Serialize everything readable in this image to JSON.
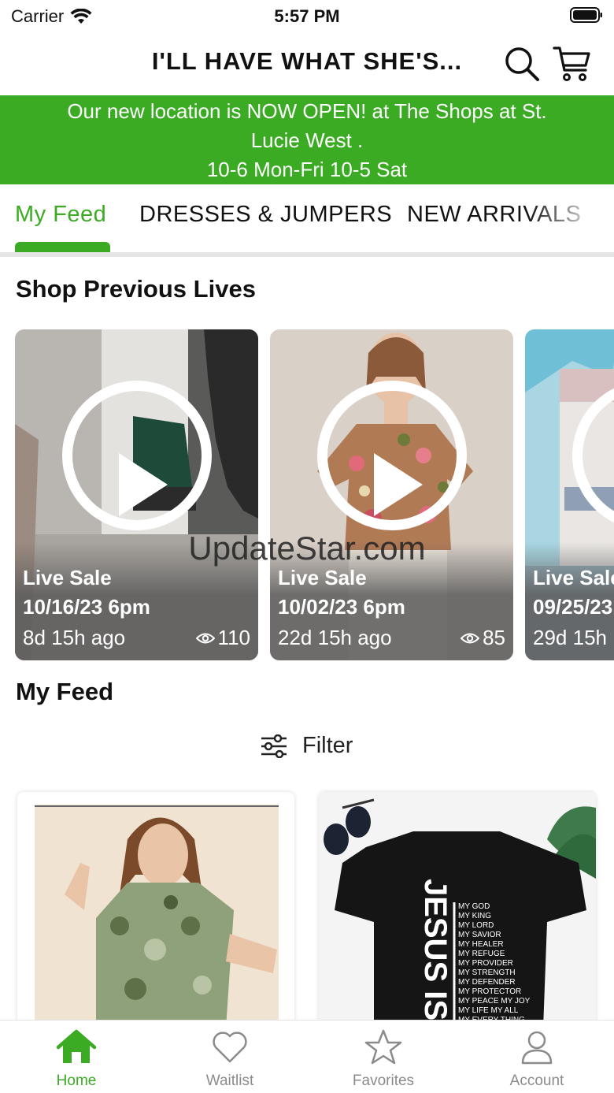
{
  "status_bar": {
    "carrier": "Carrier",
    "time": "5:57 PM"
  },
  "header": {
    "title": "I'LL HAVE WHAT SHE'S..."
  },
  "banner": {
    "lines": [
      "Our new location is NOW OPEN! at The Shops at St.",
      "Lucie West .",
      "10-6 Mon-Fri 10-5 Sat"
    ],
    "color": "#3aab23"
  },
  "tabs": [
    {
      "label": "My Feed",
      "active": true
    },
    {
      "label": "DRESSES & JUMPERS",
      "active": false
    },
    {
      "label": "NEW ARRIVALS",
      "active": false
    }
  ],
  "lives_section": {
    "title": "Shop Previous Lives",
    "cards": [
      {
        "label": "Live Sale",
        "date": "10/16/23 6pm",
        "ago": "8d 15h ago",
        "views": "110"
      },
      {
        "label": "Live Sale",
        "date": "10/02/23 6pm",
        "ago": "22d 15h ago",
        "views": "85"
      },
      {
        "label": "Live Sale",
        "date": "09/25/23",
        "ago": "29d 15h",
        "views": ""
      }
    ]
  },
  "watermark": "UpdateStar.com",
  "feed_section": {
    "title": "My Feed",
    "filter_label": "Filter"
  },
  "products": [
    {
      "image_icon": "green-floral-top-photo"
    },
    {
      "image_icon": "jesus-is-tshirt-photo",
      "shirt_text": "JESUS IS",
      "shirt_list": [
        "MY GOD",
        "MY KING",
        "MY LORD",
        "MY SAVIOR",
        "MY HEALER",
        "MY REFUGE",
        "MY PROVIDER",
        "MY STRENGTH",
        "MY DEFENDER",
        "MY PROTECTOR",
        "MY PEACE MY JOY",
        "MY LIFE MY ALL",
        "MY EVERY THING"
      ]
    }
  ],
  "bottom_nav": [
    {
      "label": "Home",
      "icon": "home-icon",
      "active": true
    },
    {
      "label": "Waitlist",
      "icon": "heart-icon",
      "active": false
    },
    {
      "label": "Favorites",
      "icon": "star-icon",
      "active": false
    },
    {
      "label": "Account",
      "icon": "user-icon",
      "active": false
    }
  ]
}
